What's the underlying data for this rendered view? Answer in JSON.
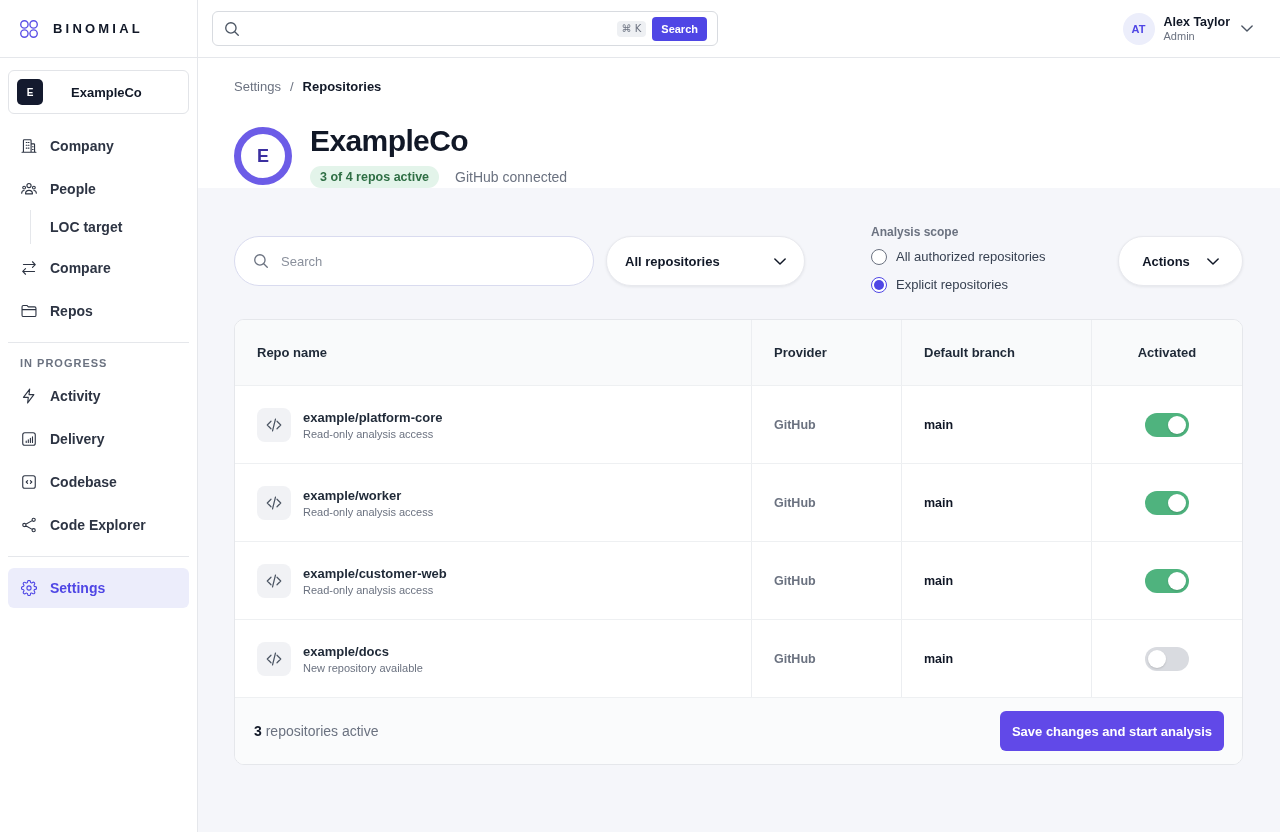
{
  "brand": {
    "name": "BINOMIAL"
  },
  "top_bar": {
    "shortcut": "⌘ K",
    "search_button": "Search"
  },
  "user": {
    "initials": "AT",
    "name": "Alex Taylor",
    "role": "Admin"
  },
  "sidebar": {
    "company": {
      "initial": "E",
      "name": "ExampleCo"
    },
    "sections": [
      {
        "items": [
          {
            "label": "Company",
            "selected": false
          },
          {
            "label": "People",
            "selected": false,
            "children": [
              {
                "label": "LOC target",
                "selected": false
              }
            ]
          },
          {
            "label": "Compare",
            "selected": false
          },
          {
            "label": "Repos",
            "selected": false
          }
        ]
      },
      {
        "heading": "IN PROGRESS",
        "items": [
          {
            "label": "Activity",
            "selected": false
          },
          {
            "label": "Delivery",
            "selected": false
          },
          {
            "label": "Codebase",
            "selected": false
          },
          {
            "label": "Code Explorer",
            "selected": false
          }
        ]
      },
      {
        "items": [
          {
            "label": "Settings",
            "selected": true
          }
        ]
      }
    ]
  },
  "breadcrumb": {
    "items": [
      "Settings",
      "Repositories"
    ],
    "separator": "/"
  },
  "header": {
    "initial": "E",
    "title": "ExampleCo",
    "badge": "3 of 4 repos active",
    "status": "GitHub connected"
  },
  "toolbar": {
    "search": {
      "placeholder": "Search"
    },
    "filter": "All repositories",
    "scope": {
      "label": "Analysis scope",
      "options": [
        {
          "label": "All authorized repositories",
          "selected": false
        },
        {
          "label": "Explicit repositories",
          "selected": true
        }
      ]
    },
    "actions": "Actions"
  },
  "table": {
    "columns": [
      "Repo name",
      "Provider",
      "Default branch",
      "Activated"
    ],
    "rows": [
      {
        "name": "example/platform-core",
        "description": "Read-only analysis access",
        "provider": "GitHub",
        "branch": "main",
        "activated": true
      },
      {
        "name": "example/worker",
        "description": "Read-only analysis access",
        "provider": "GitHub",
        "branch": "main",
        "activated": true
      },
      {
        "name": "example/customer-web",
        "description": "Read-only analysis access",
        "provider": "GitHub",
        "branch": "main",
        "activated": true
      },
      {
        "name": "example/docs",
        "description": "New repository available",
        "provider": "GitHub",
        "branch": "main",
        "activated": false
      }
    ]
  },
  "footer": {
    "summary": "**3** repositories active",
    "button": "Save changes and start analysis"
  }
}
